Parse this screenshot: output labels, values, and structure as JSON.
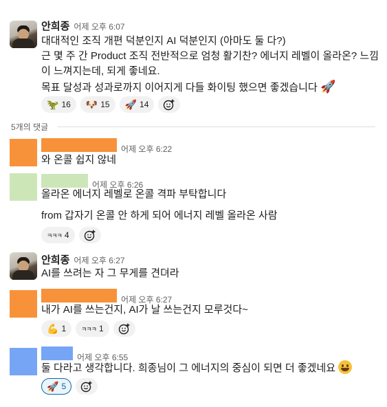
{
  "messages": {
    "m1": {
      "author": "안희종",
      "time": "어제 오후 6:07",
      "lines": [
        "대대적인 조직 개편 덕분인지 AI 덕분인지 (아마도 둘 다?)",
        "근 몇 주 간 Product 조직 전반적으로 엄청 활기찬? 에너지 레벨이 올라온? 느낌",
        "이 느껴지는데, 되게 좋네요.",
        "목표 달성과 성과로까지 이어지게 다들 화이팅 했으면 좋겠습니다"
      ],
      "reactions": [
        {
          "emoji": "🦖",
          "count": "16"
        },
        {
          "emoji": "🐶",
          "count": "15"
        },
        {
          "emoji": "🚀",
          "count": "14"
        }
      ]
    },
    "divider": "5개의 댓글",
    "r1": {
      "time": "어제 오후 6:22",
      "text": "와 온콜 쉽지 않네"
    },
    "r2": {
      "time": "어제 오후 6:26",
      "text1": "올라온 에너지 레벨로 온콜 격파 부탁합니다",
      "text2": "from 갑자기 온콜 안 하게 되어 에너지 레벨 올라온 사람",
      "reactions": [
        {
          "emoji": "ㅋㅋㅋ",
          "count": "4"
        }
      ]
    },
    "r3": {
      "author": "안희종",
      "time": "어제 오후 6:27",
      "text": "AI를 쓰려는 자 그 무게를 견뎌라"
    },
    "r4": {
      "time": "어제 오후 6:27",
      "text": "내가 AI를 쓰는건지, AI가 날 쓰는건지 모루것다~",
      "reactions": [
        {
          "emoji": "💪",
          "count": "1"
        },
        {
          "emoji": "ㅋㅋㅋ",
          "count": "1"
        }
      ]
    },
    "r5": {
      "time": "어제 오후 6:55",
      "text": "둘 다라고 생각합니다. 희종님이 그 에너지의 중심이 되면 더 좋겠네요",
      "reactions": [
        {
          "emoji": "🚀",
          "count": "5"
        }
      ]
    }
  },
  "icons": {
    "add_reaction": "add-reaction-icon",
    "rocket": "rocket-icon",
    "smile": "grinning-face-icon"
  },
  "colors": {
    "accent": "#1264a3",
    "redact_orange": "#f7923a",
    "redact_green": "#cde6b8",
    "redact_blue": "#76a5f5"
  }
}
